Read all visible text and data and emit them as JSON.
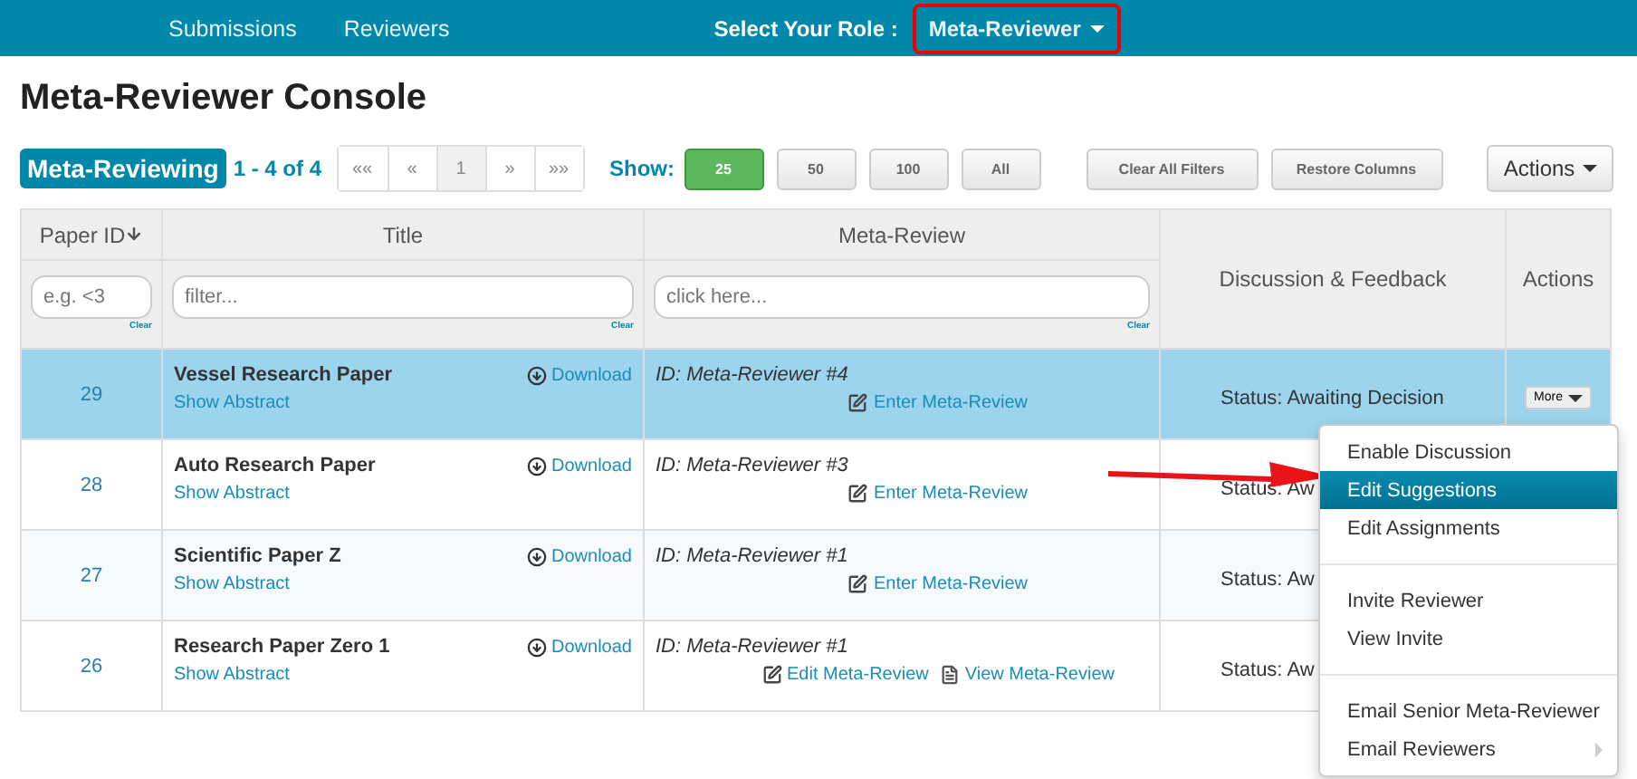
{
  "nav": {
    "links": [
      "Submissions",
      "Reviewers"
    ],
    "role_label": "Select Your Role :",
    "role": "Meta-Reviewer"
  },
  "title": "Meta-Reviewer Console",
  "toolbar": {
    "badge": "Meta-Reviewing",
    "range": "1 - 4 of 4",
    "pages": [
      {
        "label": "««",
        "selected": false
      },
      {
        "label": "«",
        "selected": false
      },
      {
        "label": "1",
        "selected": true
      },
      {
        "label": "»",
        "selected": false
      },
      {
        "label": "»»",
        "selected": false
      }
    ],
    "show_label": "Show:",
    "show": [
      {
        "label": "25",
        "selected": true
      },
      {
        "label": "50",
        "selected": false
      },
      {
        "label": "100",
        "selected": false
      },
      {
        "label": "All",
        "selected": false
      }
    ],
    "buttons": [
      "Clear All Filters",
      "Restore Columns"
    ],
    "actions": "Actions"
  },
  "table": {
    "columns": [
      "Paper ID",
      "Title",
      "Meta-Review",
      "Discussion & Feedback",
      "Actions"
    ],
    "filters": [
      {
        "placeholder": "e.g. <3",
        "clear": "Clear"
      },
      {
        "placeholder": "filter...",
        "clear": "Clear"
      },
      {
        "placeholder": "click here...",
        "clear": "Clear"
      }
    ],
    "rows": [
      {
        "id": "29",
        "title": "Vessel Research Paper",
        "abstract": "Show Abstract",
        "download": "Download",
        "reviewer": "ID: Meta-Reviewer #4",
        "links": [
          {
            "kind": "edit",
            "label": "Enter Meta-Review"
          }
        ],
        "status": "Status: Awaiting Decision",
        "more": "More",
        "selected": true
      },
      {
        "id": "28",
        "title": "Auto Research Paper",
        "abstract": "Show Abstract",
        "download": "Download",
        "reviewer": "ID: Meta-Reviewer #3",
        "links": [
          {
            "kind": "edit",
            "label": "Enter Meta-Review"
          }
        ],
        "status": "Status: Aw",
        "selected": false
      },
      {
        "id": "27",
        "title": "Scientific Paper Z",
        "abstract": "Show Abstract",
        "download": "Download",
        "reviewer": "ID: Meta-Reviewer #1",
        "links": [
          {
            "kind": "edit",
            "label": "Enter Meta-Review"
          }
        ],
        "status": "Status: Aw",
        "selected": false
      },
      {
        "id": "26",
        "title": "Research Paper Zero 1",
        "abstract": "Show Abstract",
        "download": "Download",
        "reviewer": "ID: Meta-Reviewer #1",
        "links": [
          {
            "kind": "edit",
            "label": "Edit Meta-Review"
          },
          {
            "kind": "view",
            "label": "View Meta-Review"
          }
        ],
        "status": "Status: Aw",
        "selected": false
      }
    ]
  },
  "menu": {
    "groups": [
      [
        {
          "label": "Enable Discussion",
          "selected": false,
          "submenu": false
        },
        {
          "label": "Edit Suggestions",
          "selected": true,
          "submenu": false
        },
        {
          "label": "Edit Assignments",
          "selected": false,
          "submenu": false
        }
      ],
      [
        {
          "label": "Invite Reviewer",
          "selected": false,
          "submenu": false
        },
        {
          "label": "View Invite",
          "selected": false,
          "submenu": false
        }
      ],
      [
        {
          "label": "Email Senior Meta-Reviewer",
          "selected": false,
          "submenu": false
        },
        {
          "label": "Email Reviewers",
          "selected": false,
          "submenu": true
        }
      ]
    ]
  }
}
